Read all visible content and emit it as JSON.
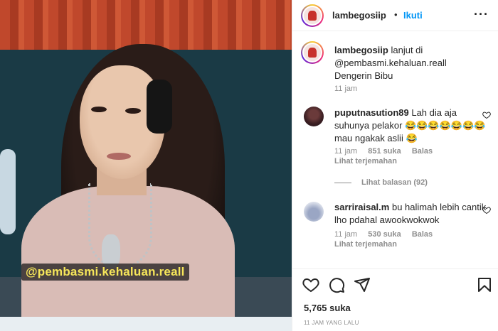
{
  "media": {
    "watermark": "@pembasmi.kehaluan.reall"
  },
  "header": {
    "username": "lambegosiip",
    "separator": "•",
    "follow_label": "Ikuti",
    "more": "···"
  },
  "caption": {
    "username": "lambegosiip",
    "lines": [
      "lanjut di",
      "@pembasmi.kehaluan.reall",
      "Dengerin Bibu"
    ],
    "time": "11 jam"
  },
  "comments": [
    {
      "username": "puputnasution89",
      "lines": [
        "Lah dia aja",
        "suhunya pelakor 😂😂😂😂😂😂😂",
        "mau ngakak aslii 😂"
      ],
      "time": "11 jam",
      "likes": "851 suka",
      "reply_label": "Balas",
      "translate_label": "Lihat terjemahan",
      "view_replies": "Lihat balasan (92)"
    },
    {
      "username": "sarriraisal.m",
      "lines": [
        "bu halimah lebih cantik",
        "lho pdahal awookwokwok"
      ],
      "time": "11 jam",
      "likes": "530 suka",
      "reply_label": "Balas",
      "translate_label": "Lihat terjemahan"
    }
  ],
  "actions": {
    "like_icon": "heart-icon",
    "comment_icon": "comment-icon",
    "share_icon": "share-icon",
    "save_icon": "bookmark-icon"
  },
  "stats": {
    "likes": "5,765 suka",
    "posted": "11 JAM YANG LALU"
  },
  "colors": {
    "accent": "#0095f6",
    "watermark": "#f6e65a",
    "muted": "#8e8e8e"
  }
}
